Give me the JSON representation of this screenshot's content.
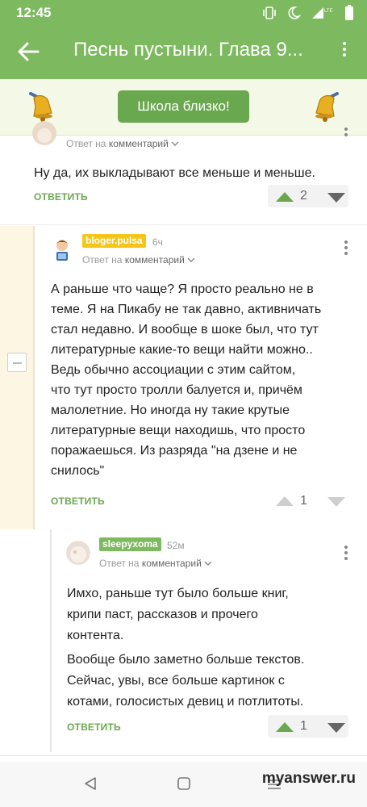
{
  "status_bar": {
    "time": "12:45",
    "icons": [
      "vibrate-icon",
      "do-not-disturb-moon-icon",
      "signal-lte-icon",
      "battery-icon"
    ],
    "lte_label": "LTE"
  },
  "header": {
    "title": "Песнь пустыни. Глава 9...",
    "background": "#7db95e"
  },
  "promo": {
    "button_label": "Школа близко!",
    "button_color": "#6aa84f"
  },
  "comments": [
    {
      "id": "c0",
      "username": "",
      "reply_to": "Ответ на",
      "reply_target": "комментарий",
      "text": "Ну да, их выкладывают все меньше и меньше.",
      "reply_label": "ОТВЕТИТЬ",
      "votes": "2",
      "upvoted": true
    },
    {
      "id": "c1",
      "username": "bloger.pulsa",
      "badge_color": "#f5c518",
      "time_ago": "6ч",
      "reply_to": "Ответ на",
      "reply_target": "комментарий",
      "text_lines": [
        "А раньше что чаще? Я просто реально не в",
        "теме. Я на Пикабу не так давно, активничать",
        "стал недавно. И вообще в шоке был, что тут",
        "литературные какие-то вещи найти можно..",
        "Ведь обычно ассоциации с этим сайтом,",
        "что тут просто тролли балуется и, причём",
        "малолетние. Но иногда ну такие крутые",
        "литературные вещи находишь, что просто",
        "поражаешься. Из разряда \"на дзене и не",
        "снилось\""
      ],
      "reply_label": "ОТВЕТИТЬ",
      "votes": "1",
      "upvoted": false
    },
    {
      "id": "c2",
      "username": "sleepyxoma",
      "badge_color": "#7db95e",
      "time_ago": "52м",
      "reply_to": "Ответ на",
      "reply_target": "комментарий",
      "paragraph1": [
        "Имхо, раньше тут было больше книг,",
        "крипи паст, рассказов и прочего",
        "контента."
      ],
      "paragraph2": [
        "Вообще было заметно больше текстов.",
        "Сейчас, увы, все больше картинок с",
        "котами, голосистых девиц и потлитоты."
      ],
      "reply_label": "ОТВЕТИТЬ",
      "votes": "1",
      "upvoted": true
    }
  ],
  "watermark": "myanswer.ru",
  "colors": {
    "accent": "#7db95e",
    "link": "#6aa84f",
    "highlight_strip": "#fdf6e3"
  }
}
